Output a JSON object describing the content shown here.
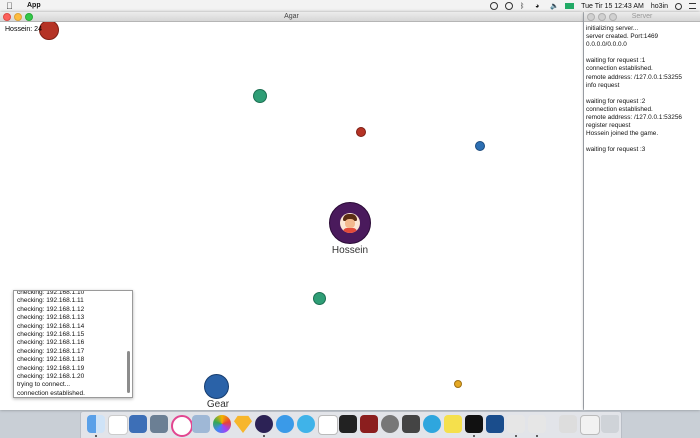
{
  "menubar": {
    "app_name": "App",
    "datetime": "Tue Tir 15  12:43 AM",
    "user": "ho3in"
  },
  "agar_window": {
    "title": "Agar",
    "score_label": "Hossein: 24",
    "players": [
      {
        "name": "Hossein",
        "color": "#4a1a5c"
      },
      {
        "name": "Gear",
        "color": "#2a62a8"
      }
    ]
  },
  "log_panel": {
    "lines": [
      "checking: 192.168.1.10",
      "checking: 192.168.1.11",
      "checking: 192.168.1.12",
      "checking: 192.168.1.13",
      "checking: 192.168.1.14",
      "checking: 192.168.1.15",
      "checking: 192.168.1.16",
      "checking: 192.168.1.17",
      "checking: 192.168.1.18",
      "checking: 192.168.1.19",
      "checking: 192.168.1.20",
      "trying to connect...",
      "connection established."
    ]
  },
  "server_window": {
    "title": "Server",
    "lines": [
      "initializing server...",
      "server created. Port:1469",
      "0.0.0.0/0.0.0.0",
      "",
      "waiting for request :1",
      "connection established.",
      "remote address: /127.0.0.1:53255",
      "info request",
      "",
      "waiting for request :2",
      "connection established.",
      "remote address: /127.0.0.1:53256",
      "register request",
      "Hossein joined the game.",
      "",
      "waiting for request :3"
    ]
  },
  "colors": {
    "food_green": "#2f9e76",
    "food_red": "#b53325",
    "food_blue": "#2c6fb3",
    "food_yellow": "#e5a823"
  }
}
